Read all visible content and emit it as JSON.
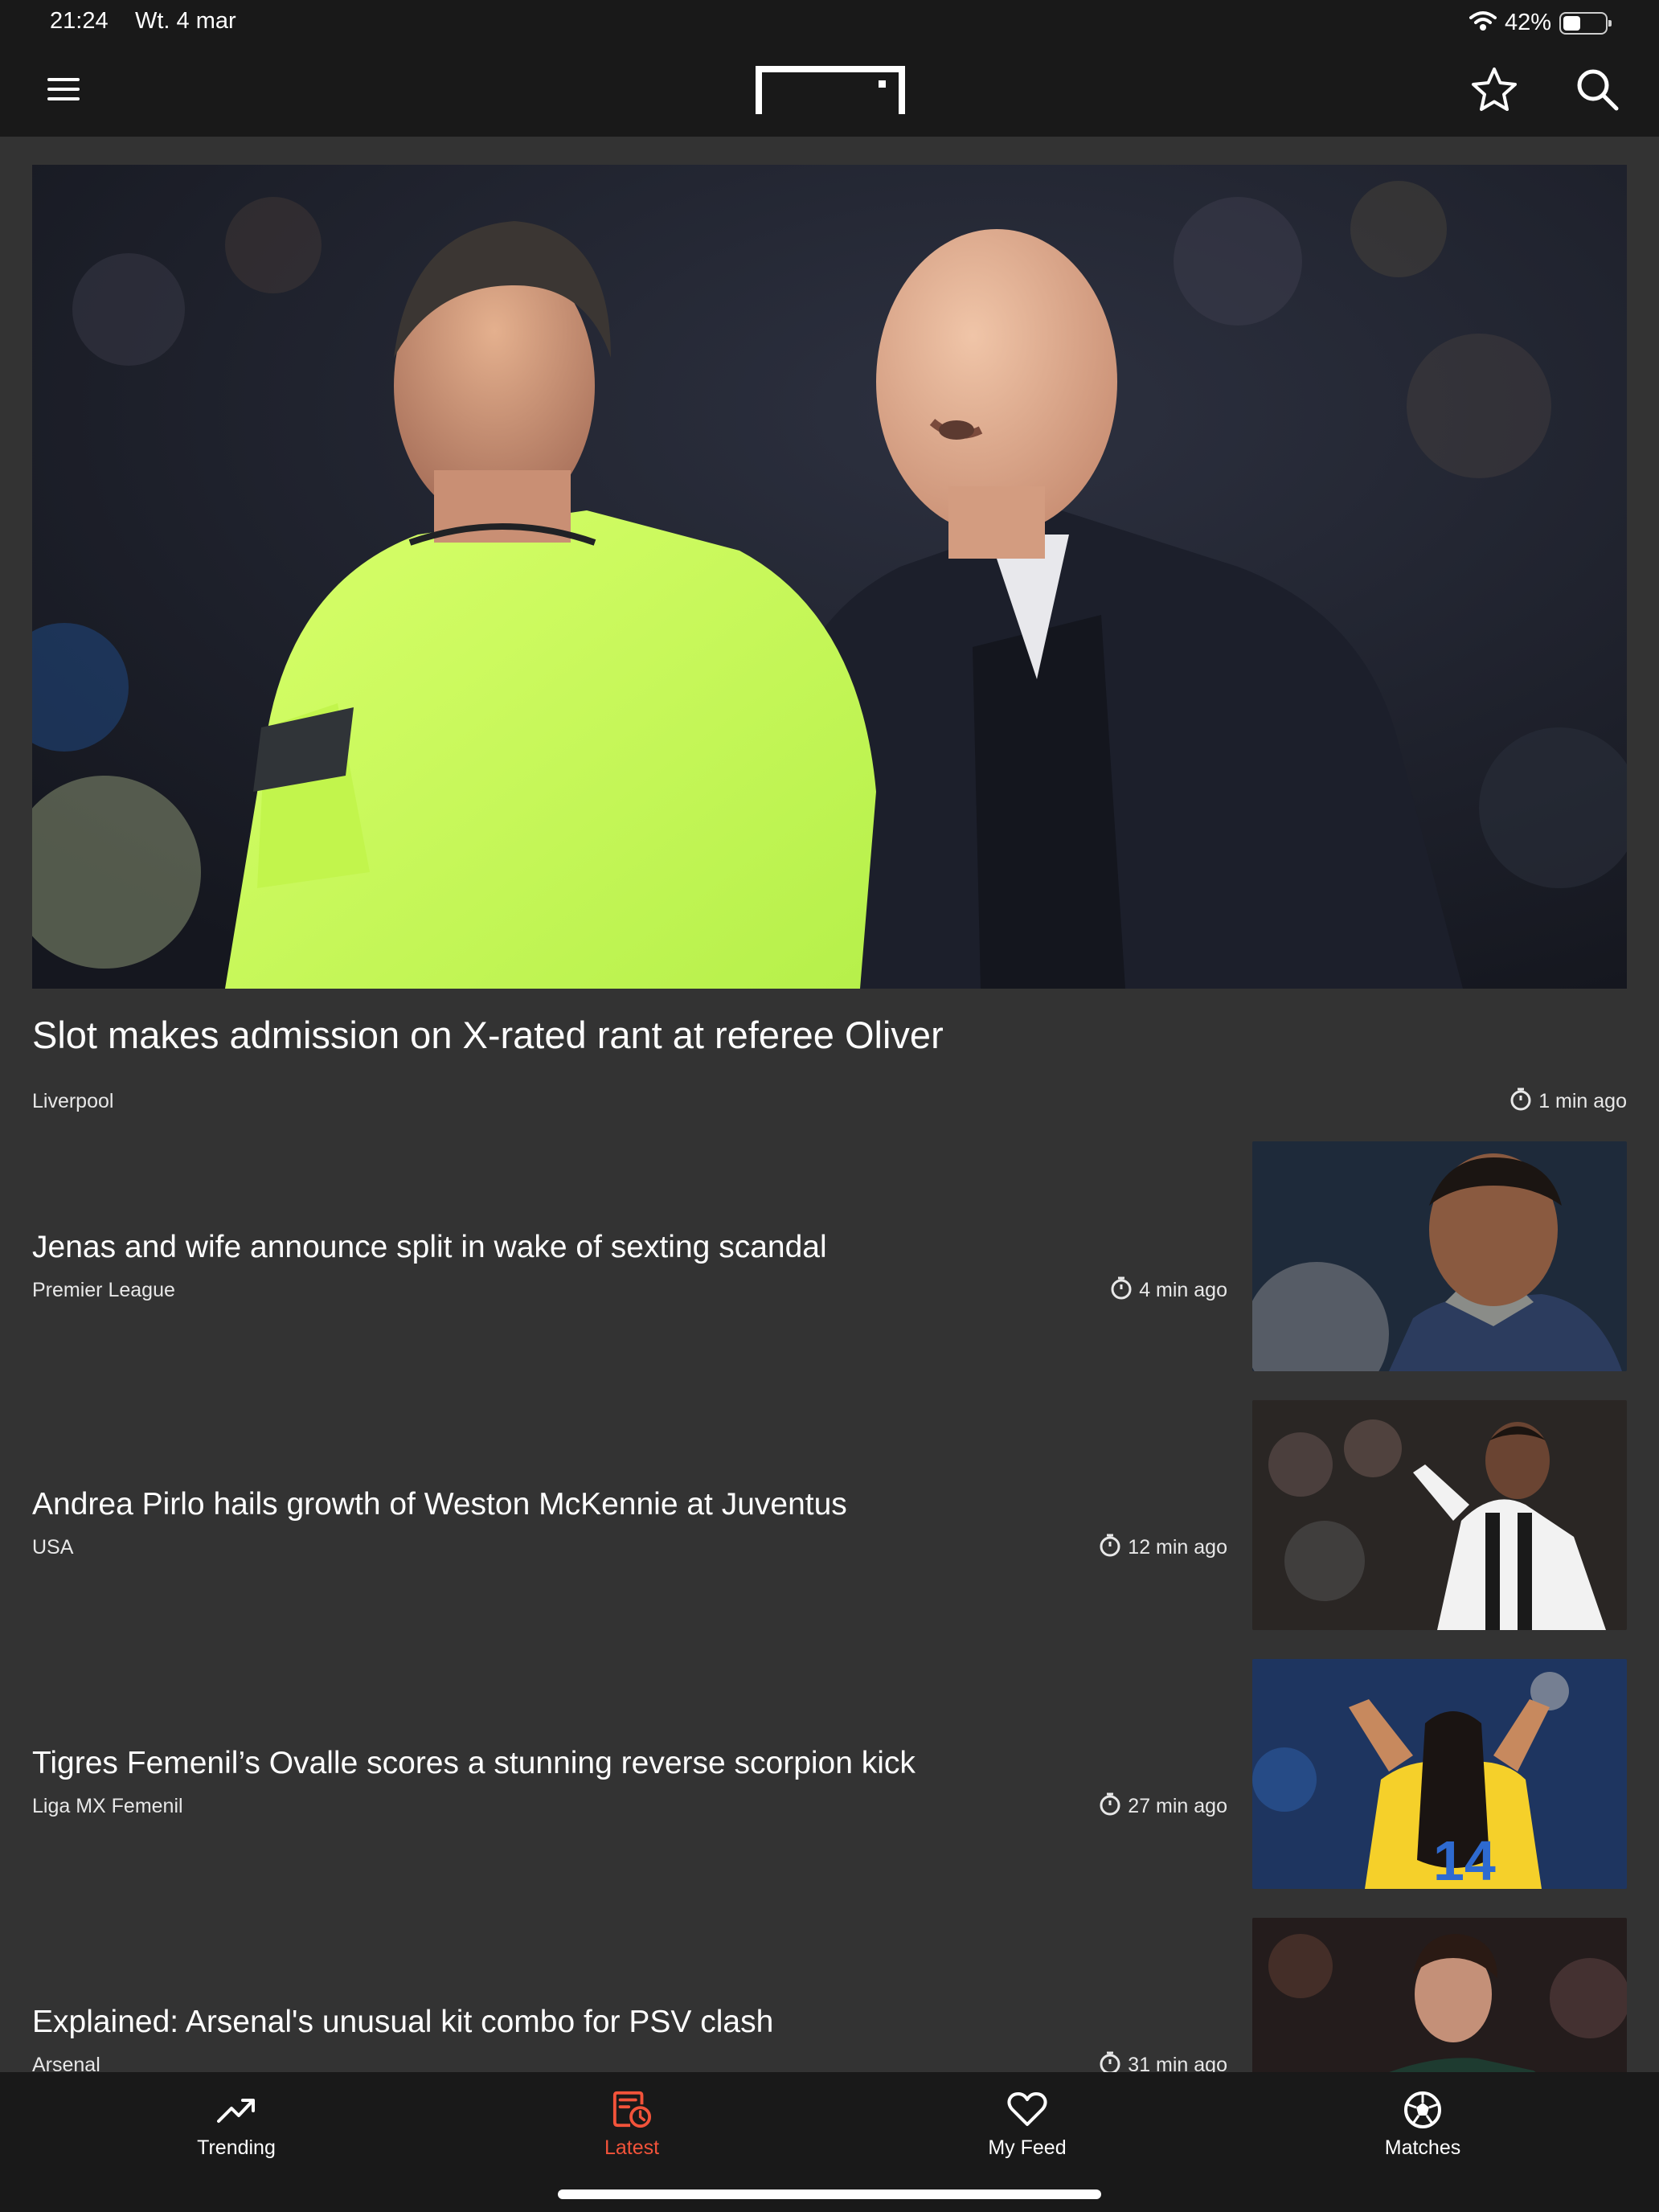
{
  "status_bar": {
    "time": "21:24",
    "date": "Wt. 4 mar",
    "battery_percent_text": "42%",
    "battery_level": 0.42
  },
  "header": {
    "menu_icon": "hamburger-menu-icon",
    "logo_icon": "goal-logo-icon",
    "favorites_icon": "star-icon",
    "search_icon": "search-icon"
  },
  "hero": {
    "title": "Slot makes admission on X-rated rant at referee Oliver",
    "category": "Liverpool",
    "time": "1 min ago"
  },
  "articles": [
    {
      "title": "Jenas and wife announce split in wake of sexting scandal",
      "category": "Premier League",
      "time": "4 min ago"
    },
    {
      "title": "Andrea Pirlo hails growth of Weston McKennie at Juventus",
      "category": "USA",
      "time": "12 min ago"
    },
    {
      "title": "Tigres Femenil’s Ovalle scores a stunning reverse scorpion kick",
      "category": "Liga MX Femenil",
      "time": "27 min ago"
    },
    {
      "title": "Explained: Arsenal's unusual kit combo for PSV clash",
      "category": "Arsenal",
      "time": "31 min ago"
    }
  ],
  "bottom_nav": {
    "items": [
      {
        "label": "Trending",
        "icon": "trending-up-icon",
        "active": false
      },
      {
        "label": "Latest",
        "icon": "latest-news-clock-icon",
        "active": true
      },
      {
        "label": "My Feed",
        "icon": "heart-icon",
        "active": false
      },
      {
        "label": "Matches",
        "icon": "football-icon",
        "active": false
      }
    ]
  },
  "colors": {
    "accent": "#f2533a",
    "background": "#333333",
    "bar": "#191919",
    "text": "#ffffff"
  }
}
